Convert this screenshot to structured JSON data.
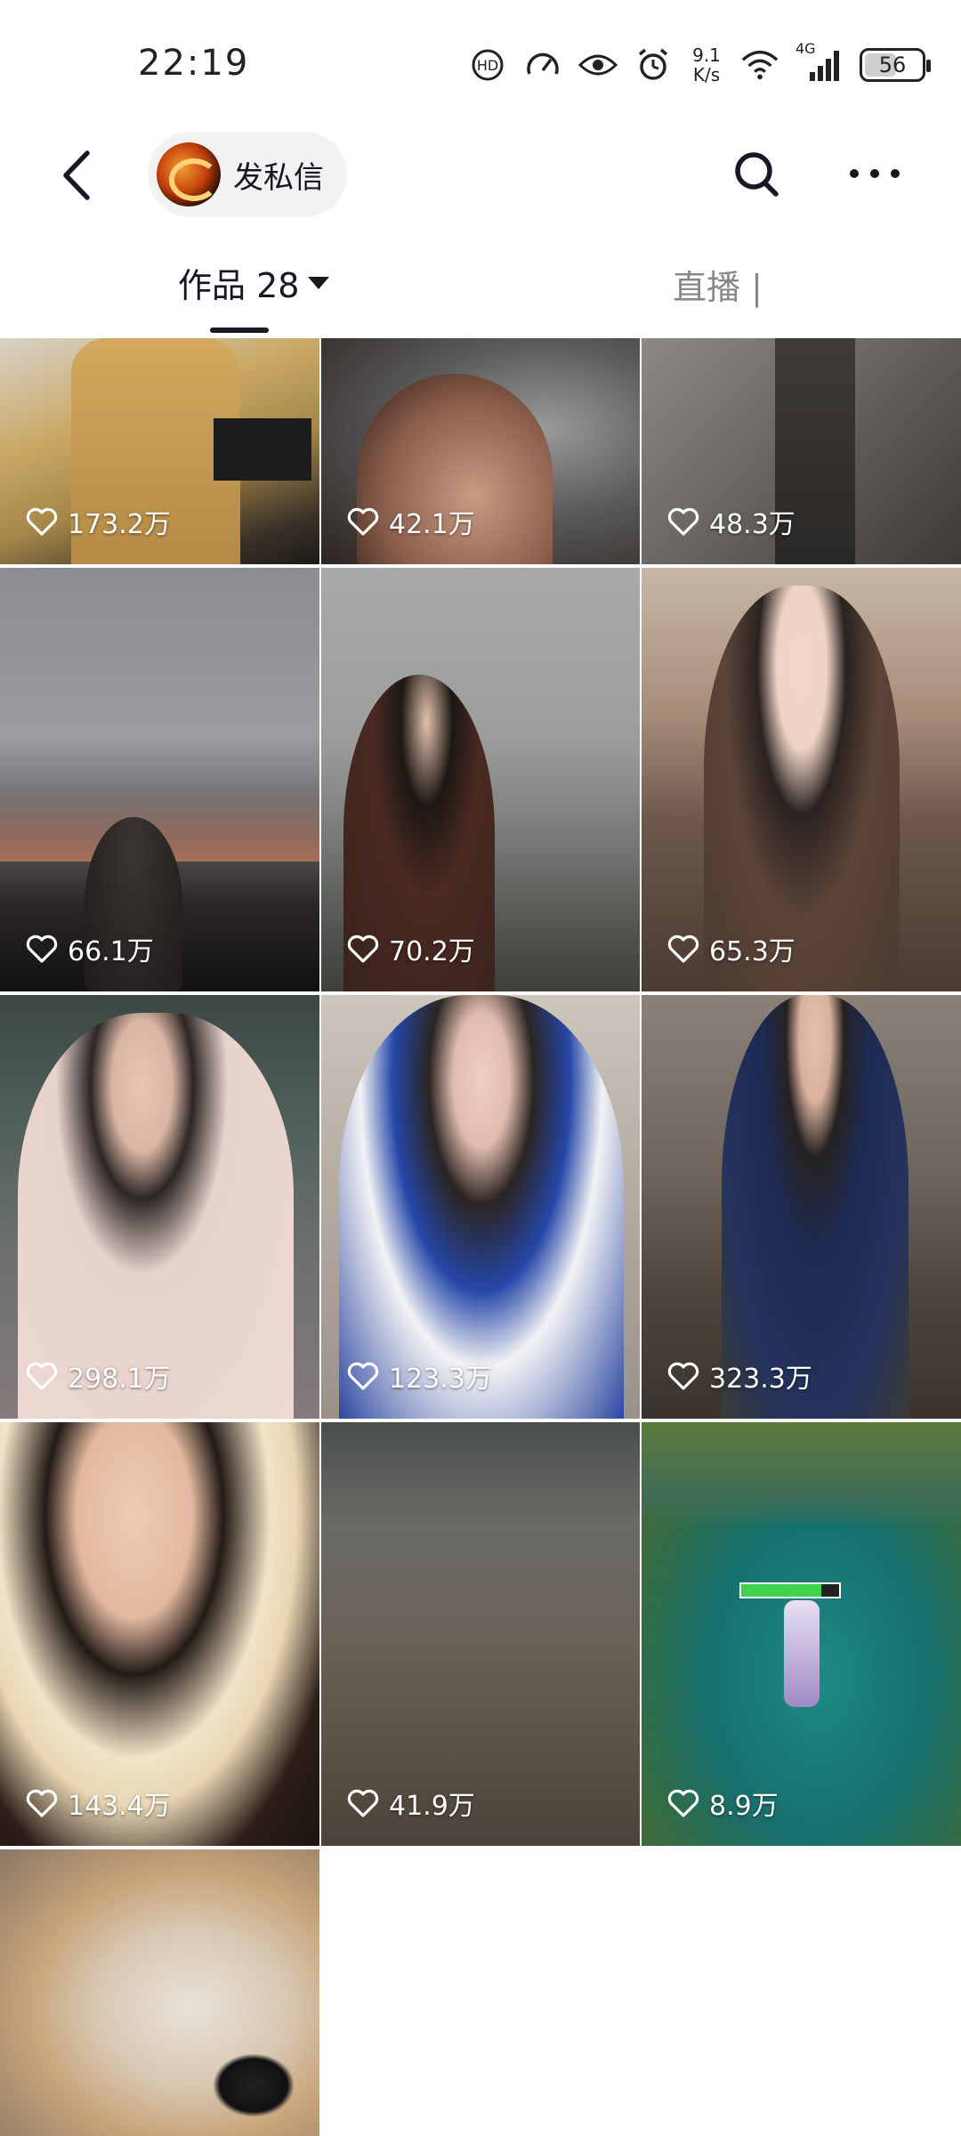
{
  "status_bar": {
    "time": "22:19",
    "net_speed_value": "9.1",
    "net_speed_unit": "K/s",
    "network": "4G",
    "battery": "56",
    "battery_level_percent": 56,
    "icons": [
      "hd-icon",
      "speed-icon",
      "eye-icon",
      "alarm-icon",
      "wifi-icon",
      "signal-icon"
    ]
  },
  "header": {
    "back_icon": "back-chevron-icon",
    "profile_chip_label": "发私信",
    "search_icon": "search-icon",
    "more_icon": "more-dots-icon"
  },
  "tabs": {
    "works_label": "作品 28",
    "live_label": "直播 |"
  },
  "colors": {
    "background": "#ffffff",
    "text": "#161823",
    "muted": "#888888"
  },
  "videos": [
    {
      "likes": "173.2万"
    },
    {
      "likes": "42.1万"
    },
    {
      "likes": "48.3万"
    },
    {
      "likes": "66.1万"
    },
    {
      "likes": "70.2万"
    },
    {
      "likes": "65.3万"
    },
    {
      "likes": "298.1万"
    },
    {
      "likes": "123.3万"
    },
    {
      "likes": "323.3万"
    },
    {
      "likes": "143.4万"
    },
    {
      "likes": "41.9万"
    },
    {
      "likes": "8.9万"
    },
    {
      "likes": ""
    }
  ]
}
